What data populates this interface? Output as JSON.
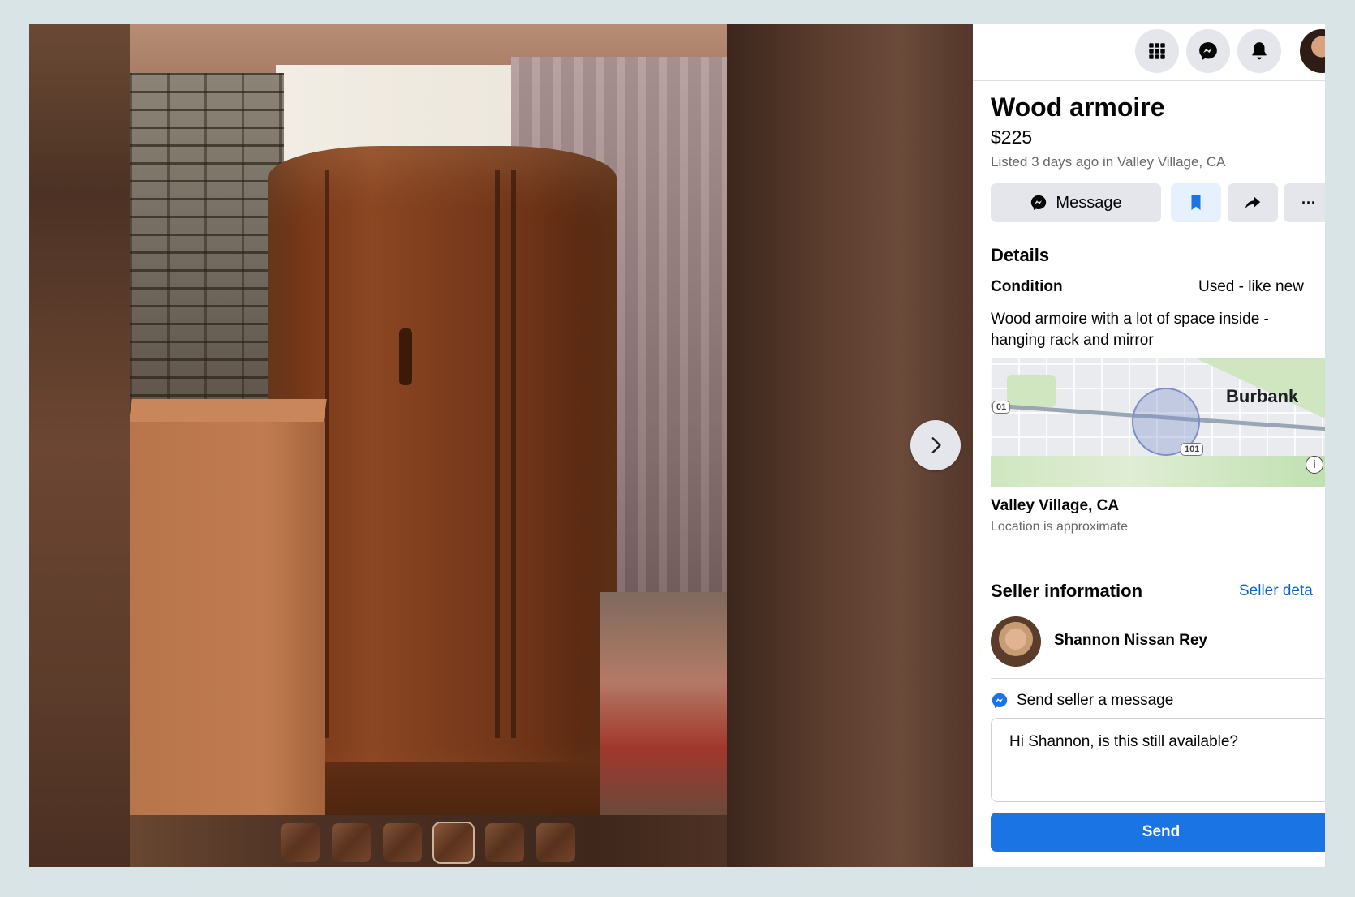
{
  "listing": {
    "title": "Wood armoire",
    "price": "$225",
    "listed": "Listed 3 days ago in Valley Village, CA"
  },
  "actions": {
    "message_label": "Message",
    "save_icon": "bookmark-icon",
    "share_icon": "share-icon",
    "more_label": "···"
  },
  "details": {
    "heading": "Details",
    "condition_label": "Condition",
    "condition_value": "Used - like new",
    "description": "Wood armoire with a lot of space inside - hanging rack and mirror"
  },
  "map": {
    "city_label": "Burbank",
    "shield_a": "01",
    "shield_b": "101",
    "info_label": "i"
  },
  "location": {
    "name": "Valley Village, CA",
    "note": "Location is approximate"
  },
  "seller": {
    "heading": "Seller information",
    "details_link": "Seller deta",
    "name": "Shannon Nissan Rey"
  },
  "message_box": {
    "label": "Send seller a message",
    "value": "Hi Shannon, is this still available?",
    "send_label": "Send"
  },
  "topbar": {
    "icons": [
      "grid-menu-icon",
      "messenger-icon",
      "bell-icon",
      "profile-avatar"
    ]
  },
  "viewer": {
    "thumbnail_count": 6,
    "active_thumbnail": 4,
    "next_icon": "chevron-right-icon"
  },
  "colors": {
    "accent": "#1b74e4",
    "link": "#0a66c2",
    "button_bg": "#e4e6eb",
    "secondary_text": "#65676b"
  }
}
